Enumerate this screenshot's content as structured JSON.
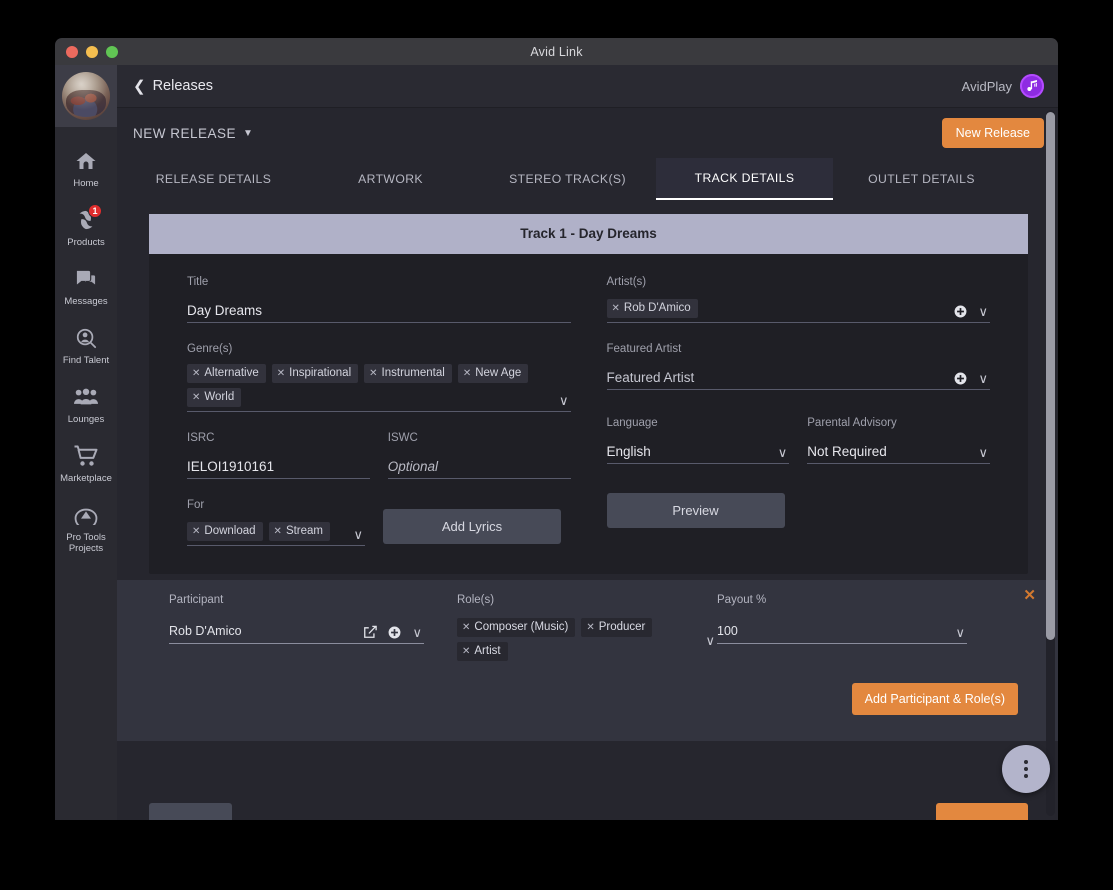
{
  "window": {
    "title": "Avid Link",
    "traffic_lights": [
      "close-red",
      "minimize-yellow",
      "maximize-green"
    ]
  },
  "colors": {
    "accent_orange": "#e3883f",
    "track_header": "#b0b1c8",
    "badge_red": "#e02d2d",
    "brand_purple": "#8e2be2",
    "panel_dark": "#1f1f25",
    "participant_panel": "#33343f"
  },
  "sidebar": {
    "avatar_name": "user-avatar",
    "items": [
      {
        "label": "Home",
        "icon": "home-icon",
        "badge": null
      },
      {
        "label": "Products",
        "icon": "products-icon",
        "badge": "1"
      },
      {
        "label": "Messages",
        "icon": "messages-icon",
        "badge": null
      },
      {
        "label": "Find Talent",
        "icon": "find-talent-icon",
        "badge": null
      },
      {
        "label": "Lounges",
        "icon": "lounges-icon",
        "badge": null
      },
      {
        "label": "Marketplace",
        "icon": "marketplace-icon",
        "badge": null
      },
      {
        "label": "Pro Tools Projects",
        "icon": "pro-tools-icon",
        "badge": null
      }
    ]
  },
  "topbar": {
    "back_label": "Releases",
    "back_icon": "chevron-left-icon",
    "brand_name": "AvidPlay",
    "brand_icon": "avidplay-music-note-icon"
  },
  "sub_header": {
    "release_selector": "NEW RELEASE",
    "release_selector_icon": "chevron-down-icon",
    "new_release_button": "New Release"
  },
  "tabs": [
    {
      "label": "RELEASE DETAILS",
      "active": false
    },
    {
      "label": "ARTWORK",
      "active": false
    },
    {
      "label": "STEREO TRACK(S)",
      "active": false
    },
    {
      "label": "TRACK DETAILS",
      "active": true
    },
    {
      "label": "OUTLET DETAILS",
      "active": false
    }
  ],
  "track": {
    "header_prefix": "Track",
    "header_number": "1",
    "header_separator": "-",
    "header_title": "Day Dreams",
    "header_full": "Track 1 - Day Dreams"
  },
  "form": {
    "title": {
      "label": "Title",
      "value": "Day Dreams"
    },
    "artists": {
      "label": "Artist(s)",
      "chips": [
        "Rob D'Amico"
      ],
      "add_icon": "plus-circle-icon",
      "dropdown_icon": "chevron-down-icon"
    },
    "genres": {
      "label": "Genre(s)",
      "chips": [
        "Alternative",
        "Inspirational",
        "Instrumental",
        "New Age",
        "World"
      ],
      "dropdown_icon": "chevron-down-icon"
    },
    "featured_artist": {
      "label": "Featured Artist",
      "placeholder": "Featured Artist",
      "value": "Featured Artist",
      "add_icon": "plus-circle-icon",
      "dropdown_icon": "chevron-down-icon"
    },
    "isrc": {
      "label": "ISRC",
      "value": "IELOI1910161"
    },
    "iswc": {
      "label": "ISWC",
      "placeholder": "Optional"
    },
    "language": {
      "label": "Language",
      "value": "English",
      "dropdown_icon": "chevron-down-icon"
    },
    "parental_advisory": {
      "label": "Parental Advisory",
      "value": "Not Required",
      "dropdown_icon": "chevron-down-icon"
    },
    "for": {
      "label": "For",
      "chips": [
        "Download",
        "Stream"
      ],
      "dropdown_icon": "chevron-down-icon"
    },
    "add_lyrics_button": "Add Lyrics",
    "preview_button": "Preview"
  },
  "participant_panel": {
    "close_icon": "close-x-icon",
    "participant": {
      "label": "Participant",
      "value": "Rob D'Amico",
      "edit_icon": "edit-pencil-icon",
      "add_icon": "plus-circle-icon",
      "dropdown_icon": "chevron-down-icon"
    },
    "roles": {
      "label": "Role(s)",
      "chips": [
        "Composer (Music)",
        "Producer",
        "Artist"
      ],
      "dropdown_icon": "chevron-down-icon"
    },
    "payout": {
      "label": "Payout %",
      "value": "100",
      "dropdown_icon": "chevron-down-icon"
    },
    "add_button": "Add Participant & Role(s)"
  },
  "fab": {
    "icon": "more-vertical-icon"
  }
}
